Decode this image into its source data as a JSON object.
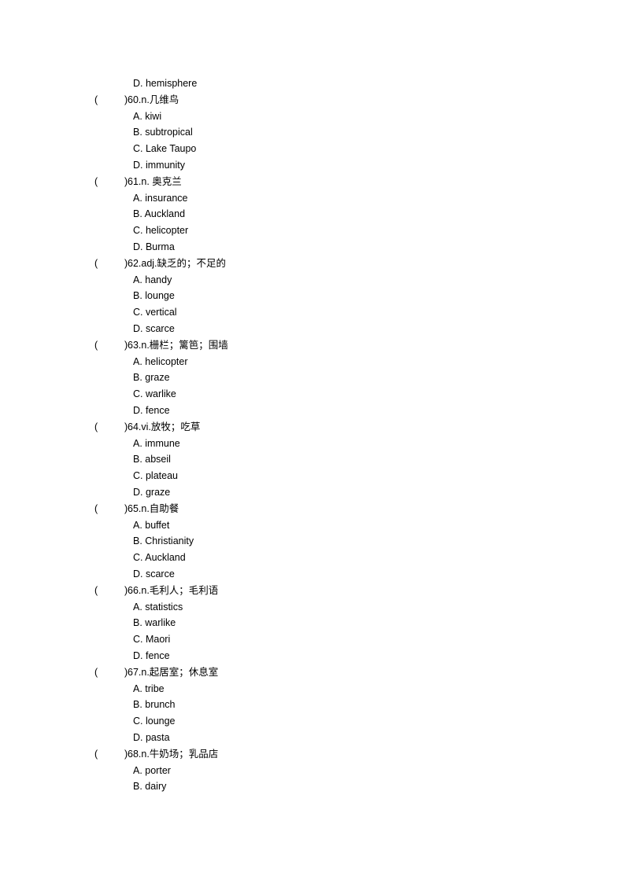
{
  "lead_option": "D. hemisphere",
  "questions": [
    {
      "stem": "60.n.几维鸟",
      "options": [
        "A. kiwi",
        "B. subtropical",
        "C. Lake Taupo",
        "D. immunity"
      ]
    },
    {
      "stem": "61.n. 奥克兰",
      "options": [
        "A. insurance",
        "B. Auckland",
        "C. helicopter",
        "D. Burma"
      ]
    },
    {
      "stem": "62.adj.缺乏的；不足的",
      "options": [
        "A. handy",
        "B. lounge",
        "C. vertical",
        "D. scarce"
      ]
    },
    {
      "stem": "63.n.栅栏；篱笆；围墙",
      "options": [
        "A. helicopter",
        "B. graze",
        "C. warlike",
        "D. fence"
      ]
    },
    {
      "stem": "64.vi.放牧；吃草",
      "options": [
        "A. immune",
        "B. abseil",
        "C. plateau",
        "D. graze"
      ]
    },
    {
      "stem": "65.n.自助餐",
      "options": [
        "A. buffet",
        "B. Christianity",
        "C. Auckland",
        "D. scarce"
      ]
    },
    {
      "stem": "66.n.毛利人；毛利语",
      "options": [
        "A. statistics",
        "B. warlike",
        "C. Maori",
        "D. fence"
      ]
    },
    {
      "stem": "67.n.起居室；休息室",
      "options": [
        "A. tribe",
        "B. brunch",
        "C. lounge",
        "D. pasta"
      ]
    },
    {
      "stem": "68.n.牛奶场；乳品店",
      "options": [
        "A. porter",
        "B. dairy"
      ]
    }
  ],
  "paren_open": "(",
  "paren_close": ")"
}
